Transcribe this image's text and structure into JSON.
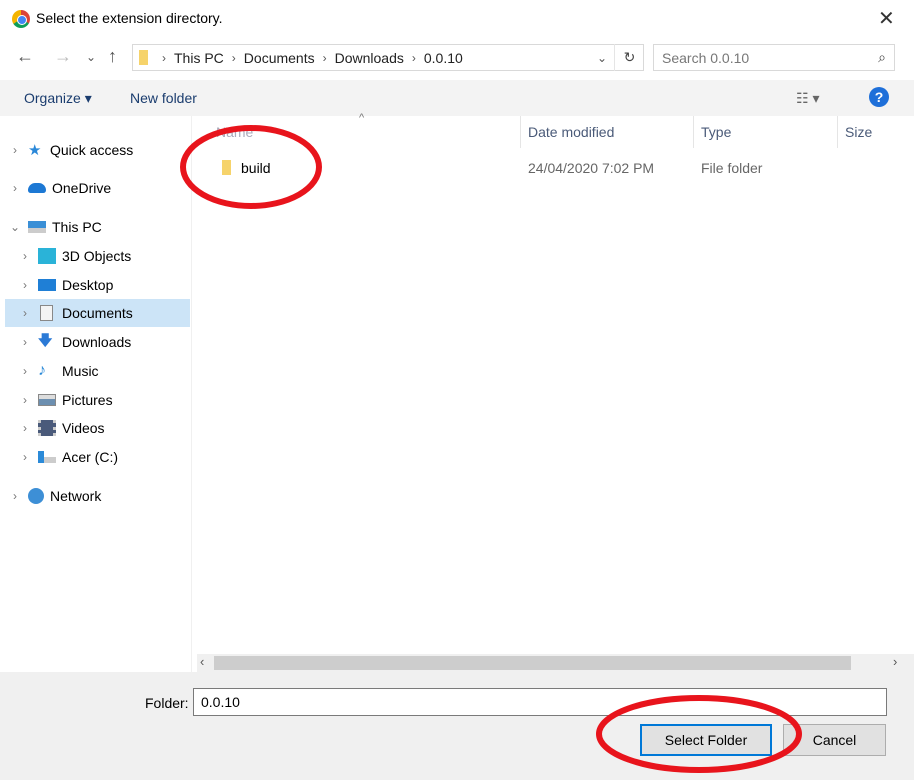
{
  "window": {
    "title": "Select the extension directory.",
    "close_label": "✕"
  },
  "address": {
    "segments": [
      "This PC",
      "Documents",
      "Downloads",
      "0.0.10"
    ]
  },
  "search": {
    "placeholder": "Search 0.0.10"
  },
  "toolbar": {
    "organize": "Organize ▾",
    "new_folder": "New folder",
    "help": "?"
  },
  "sidebar": {
    "items": [
      {
        "label": "Quick access",
        "icon": "star-icon",
        "expanded": false
      },
      {
        "label": "OneDrive",
        "icon": "cloud-icon",
        "expanded": false
      },
      {
        "label": "This PC",
        "icon": "computer-icon",
        "expanded": true
      },
      {
        "label": "3D Objects",
        "icon": "cube-icon"
      },
      {
        "label": "Desktop",
        "icon": "desktop-icon"
      },
      {
        "label": "Documents",
        "icon": "document-icon",
        "selected": true
      },
      {
        "label": "Downloads",
        "icon": "download-icon"
      },
      {
        "label": "Music",
        "icon": "music-icon"
      },
      {
        "label": "Pictures",
        "icon": "picture-icon"
      },
      {
        "label": "Videos",
        "icon": "video-icon"
      },
      {
        "label": "Acer (C:)",
        "icon": "drive-icon"
      },
      {
        "label": "Network",
        "icon": "network-icon",
        "expanded": false
      }
    ]
  },
  "columns": [
    "Name",
    "Date modified",
    "Type",
    "Size"
  ],
  "files": [
    {
      "name": "build",
      "date": "24/04/2020 7:02 PM",
      "type": "File folder"
    }
  ],
  "footer": {
    "folder_label": "Folder:",
    "folder_value": "0.0.10",
    "select_button": "Select Folder",
    "cancel_button": "Cancel"
  },
  "colors": {
    "annotation": "#e8141c",
    "selection": "#cce4f7",
    "accent": "#0078d7"
  }
}
